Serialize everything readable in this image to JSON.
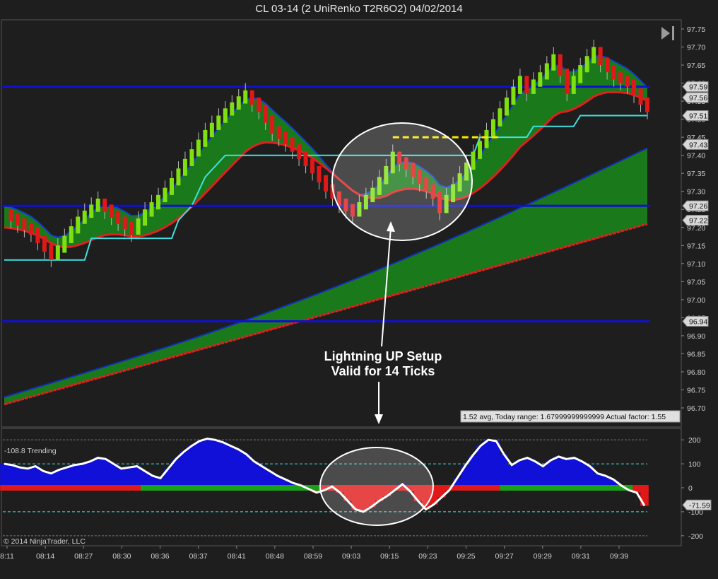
{
  "window": {
    "title": "CL 03-14 (2 UniRenko T2R6O2)  04/02/2014"
  },
  "price_panel": {
    "ticks": [
      "97.75",
      "97.70",
      "97.65",
      "97.60",
      "97.55",
      "97.50",
      "97.45",
      "97.40",
      "97.35",
      "97.30",
      "97.25",
      "97.20",
      "97.15",
      "97.10",
      "97.05",
      "97.00",
      "96.95",
      "96.90",
      "96.85",
      "96.80",
      "96.75",
      "96.70"
    ],
    "level_tags": [
      "97.59",
      "97.56",
      "97.51",
      "97.43",
      "97.26",
      "97.22",
      "96.94"
    ],
    "stats_label": "1.52 avg, Today range: 1.67999999999999  Actual factor: 1.55",
    "annotation_line1": "Lightning UP Setup",
    "annotation_line2": "Valid for 14  Ticks"
  },
  "indicator_panel": {
    "label": "-108.8 Trending",
    "ticks": [
      "200",
      "100",
      "0",
      "-100",
      "-200"
    ],
    "value_tag": "-71.59"
  },
  "x_axis": {
    "ticks": [
      "8:11",
      "08:14",
      "08:27",
      "08:30",
      "08:36",
      "08:37",
      "08:41",
      "08:48",
      "08:59",
      "09:03",
      "09:15",
      "09:23",
      "09:25",
      "09:27",
      "09:29",
      "09:31",
      "09:39"
    ]
  },
  "copyright": "© 2014 NinjaTrader, LLC",
  "colors": {
    "up": "#7fe010",
    "down": "#e01818",
    "cloud": "#1a8a1a",
    "level_line": "#1010d0",
    "cyan": "#40e0e0",
    "ma_red": "#e02020",
    "ind_blue": "#1010d8",
    "ind_red": "#e01818"
  },
  "chart_data": [
    {
      "type": "candlestick",
      "title": "CL 03-14 (2 UniRenko T2R6O2)  04/02/2014",
      "ylim": [
        96.66,
        97.78
      ],
      "x_labels": [
        "8:11",
        "08:14",
        "08:27",
        "08:30",
        "08:36",
        "08:37",
        "08:41",
        "08:48",
        "08:59",
        "09:03",
        "09:15",
        "09:23",
        "09:25",
        "09:27",
        "09:29",
        "09:31",
        "09:39"
      ],
      "close_path": [
        [
          0,
          97.24
        ],
        [
          4,
          97.19
        ],
        [
          7,
          97.12
        ],
        [
          8,
          97.14
        ],
        [
          11,
          97.22
        ],
        [
          14,
          97.27
        ],
        [
          17,
          97.22
        ],
        [
          19,
          97.19
        ],
        [
          21,
          97.24
        ],
        [
          24,
          97.3
        ],
        [
          27,
          97.38
        ],
        [
          30,
          97.46
        ],
        [
          33,
          97.52
        ],
        [
          36,
          97.57
        ],
        [
          38,
          97.53
        ],
        [
          40,
          97.47
        ],
        [
          42,
          97.44
        ],
        [
          44,
          97.4
        ],
        [
          46,
          97.36
        ],
        [
          48,
          97.31
        ],
        [
          50,
          97.27
        ],
        [
          52,
          97.24
        ],
        [
          55,
          97.3
        ],
        [
          57,
          97.36
        ],
        [
          58,
          97.4
        ],
        [
          60,
          97.37
        ],
        [
          62,
          97.33
        ],
        [
          64,
          97.29
        ],
        [
          65,
          97.25
        ],
        [
          67,
          97.31
        ],
        [
          69,
          97.37
        ],
        [
          71,
          97.43
        ],
        [
          73,
          97.49
        ],
        [
          75,
          97.55
        ],
        [
          77,
          97.61
        ],
        [
          78,
          97.58
        ],
        [
          80,
          97.62
        ],
        [
          82,
          97.67
        ],
        [
          83,
          97.63
        ],
        [
          84,
          97.58
        ],
        [
          86,
          97.64
        ],
        [
          88,
          97.69
        ],
        [
          89,
          97.66
        ],
        [
          91,
          97.62
        ],
        [
          93,
          97.6
        ],
        [
          95,
          97.55
        ],
        [
          97,
          97.51
        ]
      ],
      "horizontal_levels": [
        97.59,
        97.26,
        96.94
      ],
      "level_tags": [
        97.59,
        97.56,
        97.51,
        97.43,
        97.26,
        97.22,
        96.94
      ],
      "setup_level": 97.45
    },
    {
      "type": "oscillator",
      "label": "-108.8 Trending",
      "ylim": [
        -230,
        230
      ],
      "reference_levels": [
        200,
        100,
        0,
        -100,
        -200
      ],
      "values": [
        100,
        95,
        85,
        80,
        90,
        70,
        60,
        75,
        85,
        95,
        100,
        110,
        125,
        120,
        100,
        80,
        85,
        90,
        70,
        50,
        40,
        80,
        120,
        150,
        175,
        195,
        205,
        200,
        190,
        175,
        160,
        140,
        110,
        90,
        70,
        50,
        35,
        20,
        10,
        -5,
        -20,
        -10,
        5,
        -20,
        -55,
        -90,
        -100,
        -80,
        -55,
        -35,
        -10,
        15,
        -15,
        -55,
        -90,
        -70,
        -40,
        -10,
        40,
        90,
        135,
        175,
        200,
        195,
        140,
        95,
        115,
        125,
        110,
        90,
        115,
        130,
        120,
        125,
        110,
        90,
        60,
        50,
        35,
        10,
        -10,
        -20,
        -75
      ]
    }
  ]
}
